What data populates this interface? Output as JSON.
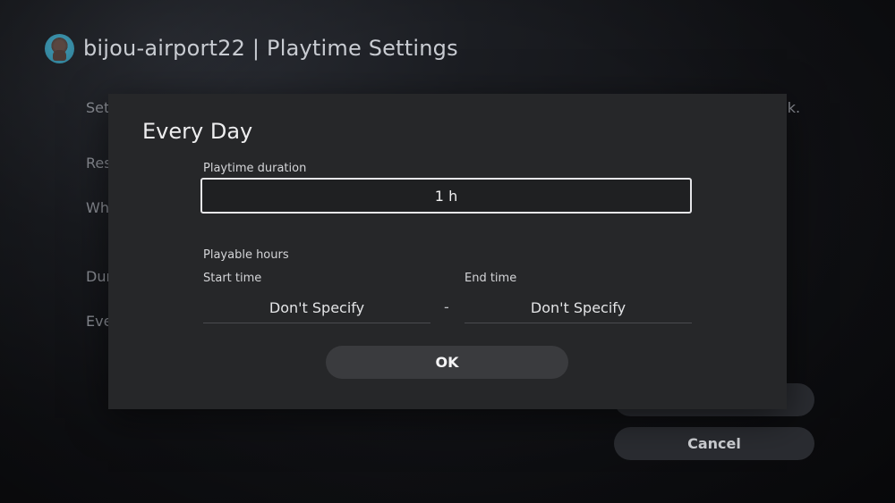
{
  "header": {
    "username": "bijou-airport22",
    "title": "bijou-airport22 | Playtime Settings"
  },
  "background": {
    "lines": [
      "Set",
      "eek.",
      "Res",
      "Wh",
      "Dur",
      "Eve"
    ],
    "buttons": [
      "",
      "Cancel"
    ]
  },
  "dialog": {
    "title": "Every Day",
    "duration_label": "Playtime duration",
    "duration_value": "1 h",
    "playable_hours_label": "Playable hours",
    "start_label": "Start time",
    "start_value": "Don't Specify",
    "separator": "-",
    "end_label": "End time",
    "end_value": "Don't Specify",
    "ok_label": "OK"
  }
}
